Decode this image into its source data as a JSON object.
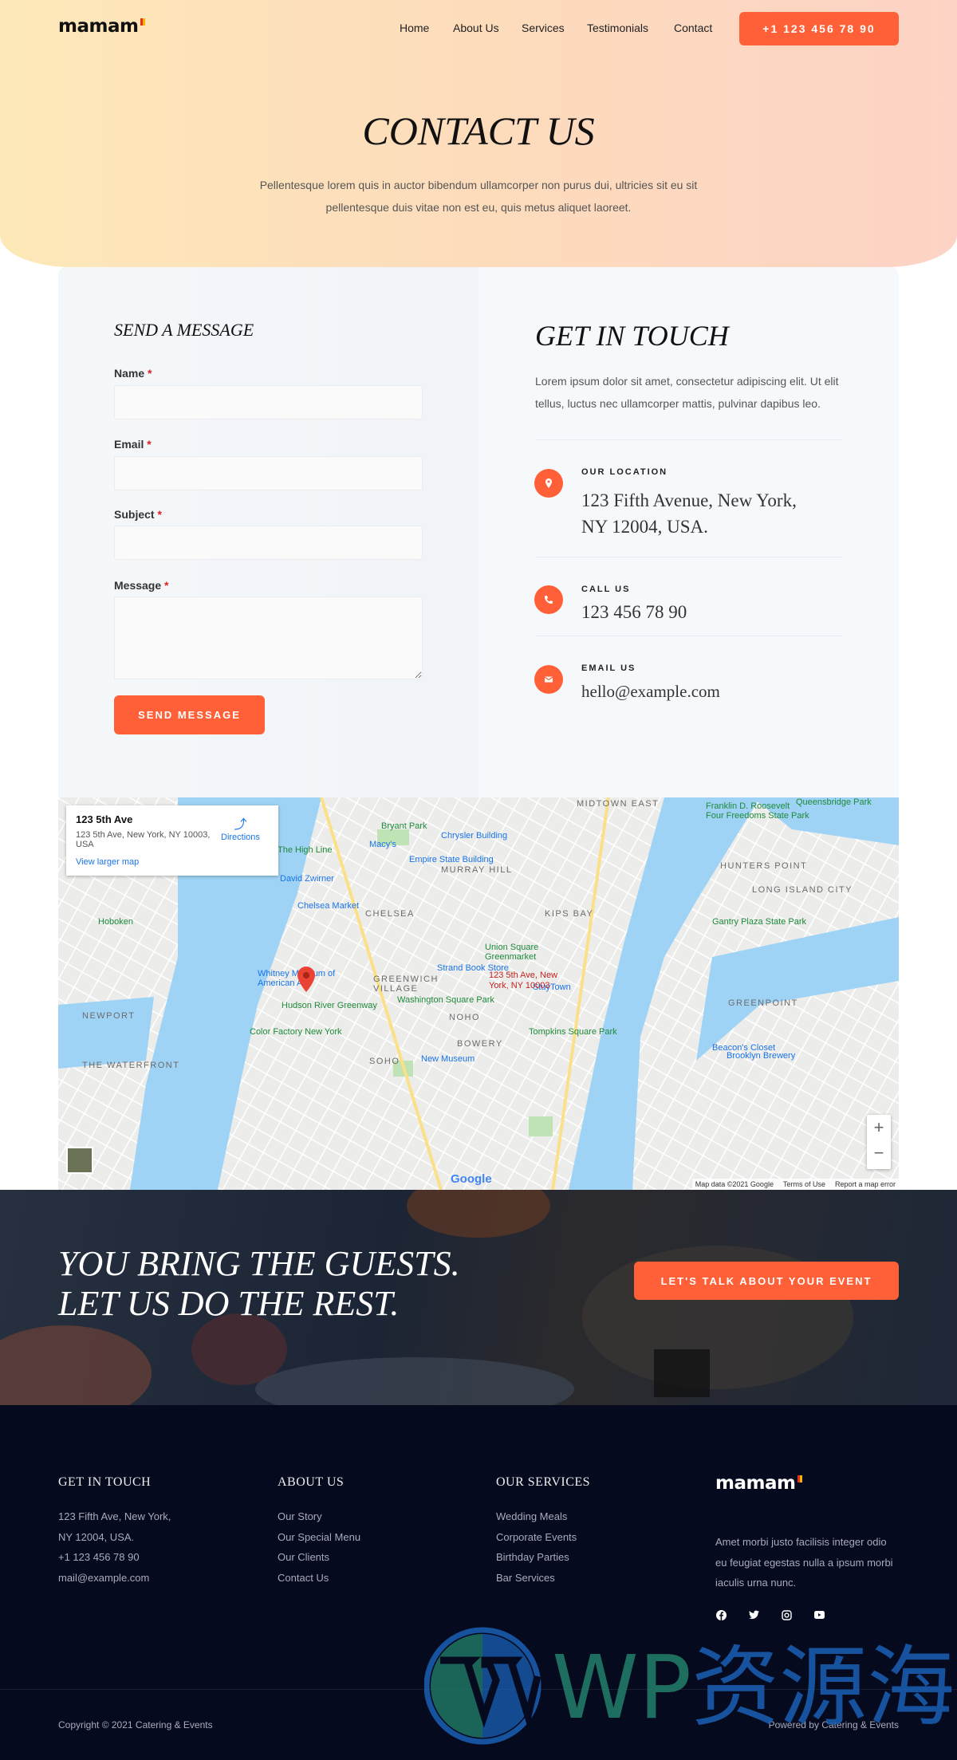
{
  "header": {
    "logo": "mamam",
    "nav": [
      "Home",
      "About Us",
      "Services",
      "Testimonials",
      "Contact"
    ],
    "phone_button": "+1 123 456 78 90"
  },
  "hero": {
    "title": "CONTACT US",
    "subtitle_line1": "Pellentesque lorem quis in auctor bibendum ullamcorper non purus dui, ultricies sit eu sit",
    "subtitle_line2": "pellentesque duis vitae non est eu, quis metus aliquet laoreet."
  },
  "form": {
    "title": "SEND A MESSAGE",
    "fields": [
      {
        "label": "Name",
        "required": "*",
        "value": ""
      },
      {
        "label": "Email",
        "required": "*",
        "value": ""
      },
      {
        "label": "Subject",
        "required": "*",
        "value": ""
      },
      {
        "label": "Message",
        "required": "*",
        "value": ""
      }
    ],
    "submit": "SEND MESSAGE"
  },
  "contact": {
    "title": "GET IN TOUCH",
    "text_line1": "Lorem ipsum dolor sit amet, consectetur adipiscing elit. Ut elit",
    "text_line2": "tellus, luctus nec ullamcorper mattis, pulvinar dapibus leo.",
    "items": [
      {
        "icon": "map-pin-icon",
        "label": "OUR LOCATION",
        "value_line1": "123 Fifth Avenue, New York,",
        "value_line2": "NY 12004, USA."
      },
      {
        "icon": "phone-icon",
        "label": "CALL US",
        "value_line1": "123 456 78 90"
      },
      {
        "icon": "envelope-icon",
        "label": "EMAIL US",
        "value_line1": "hello@example.com"
      }
    ]
  },
  "map": {
    "place_title": "123 5th Ave",
    "place_address": "123 5th Ave, New York, NY 10003, USA",
    "directions": "Directions",
    "view_larger": "View larger map",
    "marker_label": "123 5th Ave, New York, NY 10003",
    "labels": [
      "MIDTOWN EAST",
      "Bryant Park",
      "Chrysler Building",
      "Macy's",
      "Empire State Building",
      "MURRAY HILL",
      "HUNTERS POINT",
      "LONG ISLAND CITY",
      "CHELSEA",
      "Chelsea Market",
      "The High Line",
      "Hoboken",
      "KIPS BAY",
      "Union Square Greenmarket",
      "Strand Book Store",
      "GREENWICH VILLAGE",
      "StuyTown",
      "GREENPOINT",
      "NOHO",
      "Washington Square Park",
      "Hudson River Greenway",
      "NEWPORT",
      "Color Factory New York",
      "Tompkins Square Park",
      "BOWERY",
      "SOHO",
      "New Museum",
      "Brooklyn Brewery",
      "Beacon's Closet",
      "THE WATERFRONT",
      "Whitney Museum of American Art",
      "David Zwirner",
      "Gantry Plaza State Park",
      "Franklin D. Roosevelt Four Freedoms State Park",
      "Queensbridge Park"
    ],
    "zoom_in": "+",
    "zoom_out": "−",
    "attribution": "Map data ©2021 Google",
    "terms": "Terms of Use",
    "report": "Report a map error",
    "google": "Google"
  },
  "cta": {
    "line1": "YOU BRING THE GUESTS.",
    "line2": "LET US DO THE REST.",
    "button": "LET'S TALK ABOUT YOUR EVENT"
  },
  "footer": {
    "col1": {
      "title": "GET IN TOUCH",
      "lines": [
        "123 Fifth Ave, New York,",
        "NY 12004, USA.",
        "+1 123 456 78 90",
        "mail@example.com"
      ]
    },
    "col2": {
      "title": "ABOUT US",
      "links": [
        "Our Story",
        "Our Special Menu",
        "Our Clients",
        "Contact Us"
      ]
    },
    "col3": {
      "title": "OUR SERVICES",
      "links": [
        "Wedding Meals",
        "Corporate Events",
        "Birthday Parties",
        "Bar Services"
      ]
    },
    "col4": {
      "logo": "mamam",
      "lines": [
        "Amet morbi justo facilisis integer odio",
        "eu feugiat egestas nulla a ipsum morbi",
        "iaculis urna nunc."
      ],
      "social": [
        "facebook-icon",
        "twitter-icon",
        "instagram-icon",
        "youtube-icon"
      ]
    },
    "copyright": "Copyright © 2021 Catering & Events",
    "powered": "Powered by Catering & Events",
    "watermark": "WP资源海"
  },
  "colors": {
    "accent": "#ff6037",
    "footer_bg": "#050a1e",
    "hero_left": "#fde8b8",
    "hero_right": "#fdd3c5"
  }
}
